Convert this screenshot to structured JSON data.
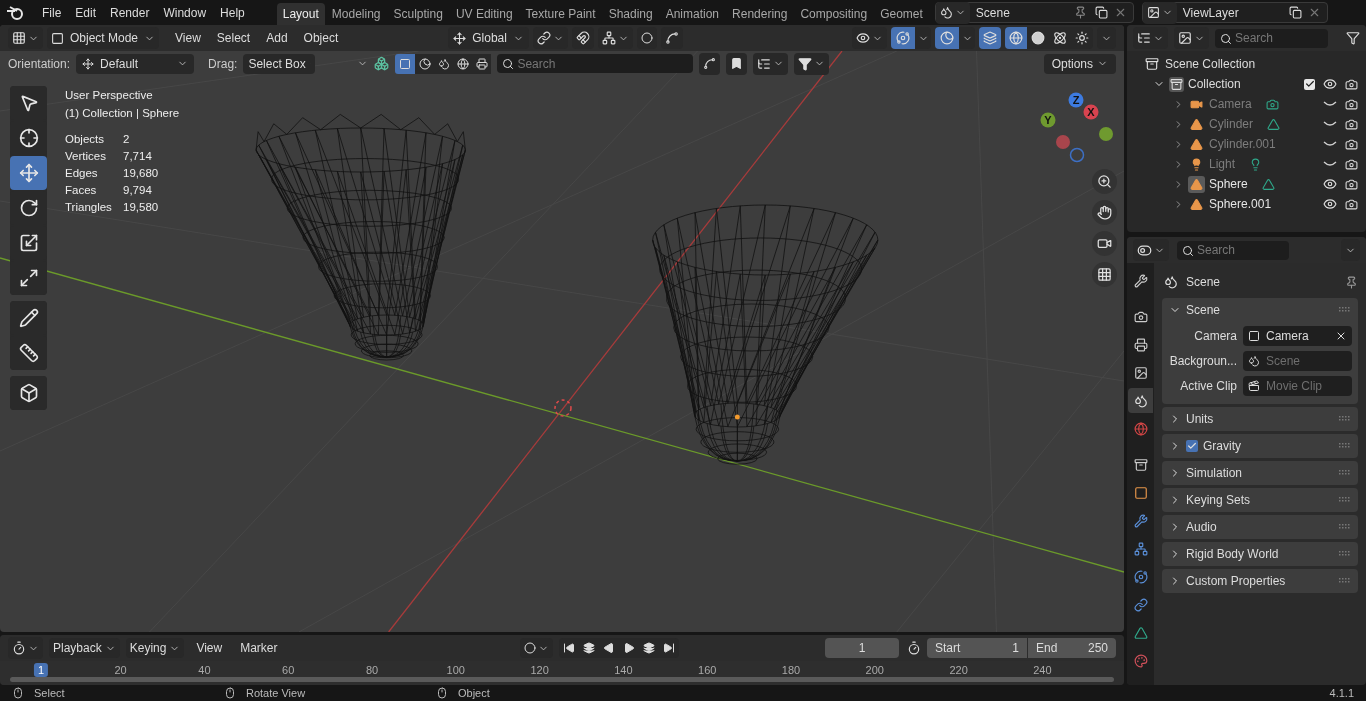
{
  "top_bar": {
    "menus": [
      "File",
      "Edit",
      "Render",
      "Window",
      "Help"
    ],
    "workspaces": [
      {
        "label": "Layout",
        "selected": true
      },
      {
        "label": "Modeling",
        "selected": false
      },
      {
        "label": "Sculpting",
        "selected": false
      },
      {
        "label": "UV Editing",
        "selected": false
      },
      {
        "label": "Texture Paint",
        "selected": false
      },
      {
        "label": "Shading",
        "selected": false
      },
      {
        "label": "Animation",
        "selected": false
      },
      {
        "label": "Rendering",
        "selected": false
      },
      {
        "label": "Compositing",
        "selected": false
      },
      {
        "label": "Geomet",
        "selected": false
      }
    ],
    "scene": "Scene",
    "view_layer": "ViewLayer"
  },
  "viewport": {
    "header": {
      "mode": "Object Mode",
      "menus": [
        "View",
        "Select",
        "Add",
        "Object"
      ],
      "orientation": "Global",
      "gizmos_on": true,
      "overlays_on": true,
      "xray_on": true,
      "shading": [
        {
          "kind": "wireframe",
          "selected": true
        },
        {
          "kind": "solid",
          "selected": false
        },
        {
          "kind": "material",
          "selected": false
        },
        {
          "kind": "rendered",
          "selected": false
        }
      ]
    },
    "tool_settings": {
      "orientation_label": "Orientation:",
      "orientation": "Default",
      "drag_label": "Drag:",
      "drag": "Select Box",
      "search_placeholder": "Search",
      "options": "Options"
    },
    "tools": [
      {
        "kind": "select",
        "selected": false
      },
      {
        "kind": "cursor",
        "selected": false
      },
      {
        "kind": "move",
        "selected": true
      },
      {
        "kind": "rotate",
        "selected": false
      },
      {
        "kind": "scale",
        "selected": false
      },
      {
        "kind": "transform",
        "selected": false
      },
      {
        "kind": "annotate",
        "selected": false
      },
      {
        "kind": "measure",
        "selected": false
      },
      {
        "kind": "add_cube",
        "selected": false
      }
    ],
    "overlay": {
      "view": "User Perspective",
      "context": "(1) Collection | Sphere",
      "stats": [
        {
          "label": "Objects",
          "value": "2"
        },
        {
          "label": "Vertices",
          "value": "7,714"
        },
        {
          "label": "Edges",
          "value": "19,680"
        },
        {
          "label": "Faces",
          "value": "9,794"
        },
        {
          "label": "Triangles",
          "value": "19,580"
        }
      ]
    },
    "gizmo": {
      "x": "X",
      "y": "Y",
      "z": "Z"
    }
  },
  "outliner": {
    "search_placeholder": "Search",
    "root": "Scene Collection",
    "collection": {
      "name": "Collection",
      "expanded": true,
      "checked": true,
      "children": [
        {
          "name": "Camera",
          "kind": "camera",
          "data_icon": true,
          "visible": false,
          "active": false
        },
        {
          "name": "Cylinder",
          "kind": "mesh",
          "data_icon": true,
          "visible": false,
          "active": false
        },
        {
          "name": "Cylinder.001",
          "kind": "mesh",
          "data_icon": false,
          "visible": false,
          "active": false
        },
        {
          "name": "Light",
          "kind": "light",
          "data_icon": true,
          "visible": false,
          "active": false
        },
        {
          "name": "Sphere",
          "kind": "mesh",
          "data_icon": true,
          "visible": true,
          "active": true
        },
        {
          "name": "Sphere.001",
          "kind": "mesh",
          "data_icon": false,
          "visible": true,
          "active": false
        }
      ]
    }
  },
  "properties": {
    "search_placeholder": "Search",
    "context": "Scene",
    "tabs": [
      {
        "kind": "tool",
        "selected": false
      },
      {
        "kind": "render",
        "selected": false
      },
      {
        "kind": "output",
        "selected": false
      },
      {
        "kind": "view_layer",
        "selected": false
      },
      {
        "kind": "scene",
        "selected": true
      },
      {
        "kind": "world",
        "selected": false
      },
      {
        "kind": "collection",
        "selected": false
      },
      {
        "kind": "object",
        "selected": false
      },
      {
        "kind": "modifiers",
        "selected": false
      },
      {
        "kind": "particles",
        "selected": false
      },
      {
        "kind": "physics",
        "selected": false
      },
      {
        "kind": "constraints",
        "selected": false
      },
      {
        "kind": "data",
        "selected": false
      },
      {
        "kind": "material",
        "selected": false
      }
    ],
    "panels": [
      {
        "title": "Scene",
        "expanded": true,
        "fields": [
          {
            "label": "Camera",
            "kind": "camera",
            "value": "Camera"
          },
          {
            "label": "Backgroun...",
            "kind": "scene",
            "placeholder": "Scene"
          },
          {
            "label": "Active Clip",
            "kind": "clip",
            "placeholder": "Movie Clip"
          }
        ]
      },
      {
        "title": "Units",
        "expanded": false
      },
      {
        "title": "Gravity",
        "expanded": false,
        "checked": true
      },
      {
        "title": "Simulation",
        "expanded": false
      },
      {
        "title": "Keying Sets",
        "expanded": false
      },
      {
        "title": "Audio",
        "expanded": false
      },
      {
        "title": "Rigid Body World",
        "expanded": false
      },
      {
        "title": "Custom Properties",
        "expanded": false
      }
    ]
  },
  "timeline": {
    "menus": [
      "Playback",
      "Keying",
      "View",
      "Marker"
    ],
    "current_frame": "1",
    "start_label": "Start",
    "start": "1",
    "end_label": "End",
    "end": "250",
    "ruler": {
      "current": "1",
      "ticks": [
        "20",
        "40",
        "60",
        "80",
        "100",
        "120",
        "140",
        "160",
        "180",
        "200",
        "220",
        "240"
      ]
    }
  },
  "status_bar": {
    "items": [
      "Select",
      "Rotate View",
      "Object"
    ],
    "version": "4.1.1"
  }
}
